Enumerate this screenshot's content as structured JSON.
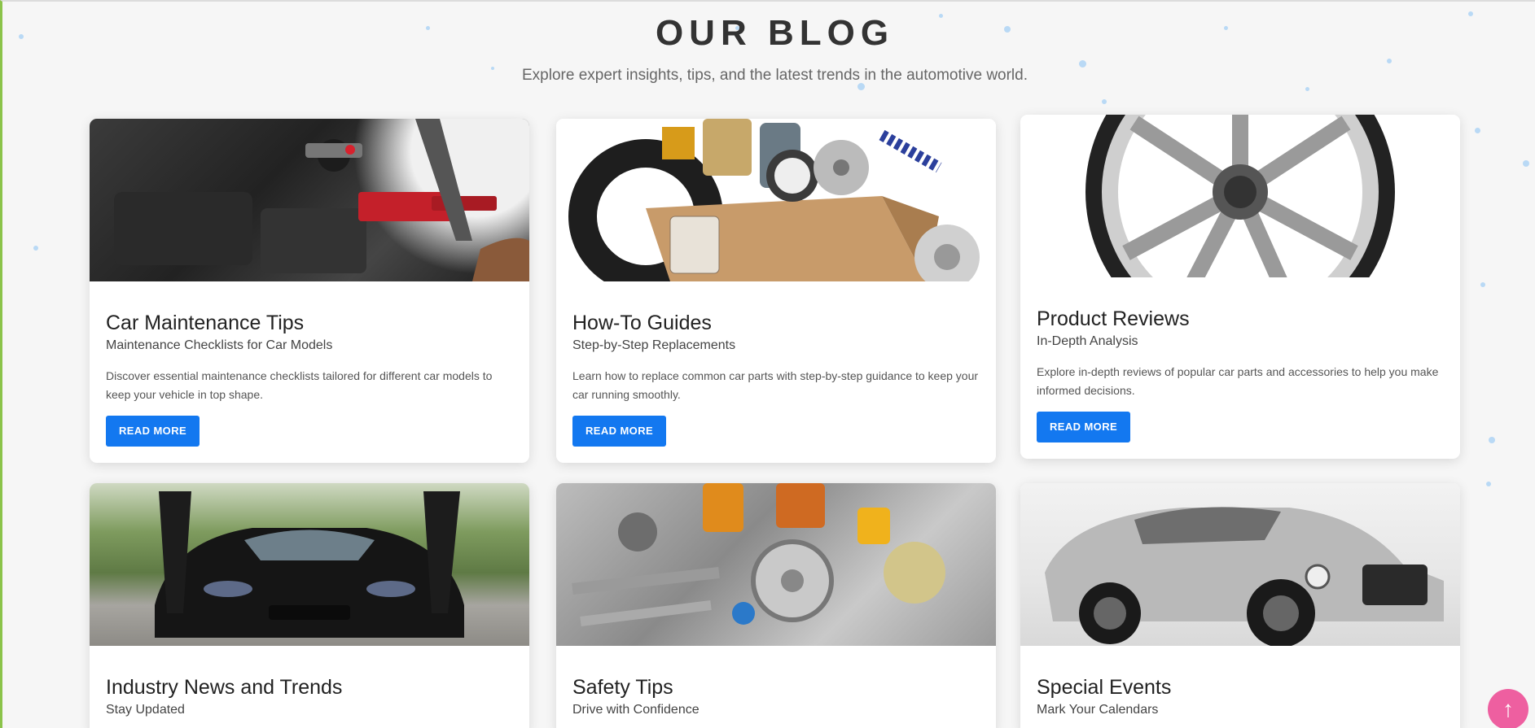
{
  "blog": {
    "title": "OUR BLOG",
    "subtitle": "Explore expert insights, tips, and the latest trends in the automotive world."
  },
  "cards": [
    {
      "title": "Car Maintenance Tips",
      "subtitle": "Maintenance Checklists for Car Models",
      "text": "Discover essential maintenance checklists tailored for different car models to keep your vehicle in top shape.",
      "button": "READ MORE"
    },
    {
      "title": "How-To Guides",
      "subtitle": "Step-by-Step Replacements",
      "text": "Learn how to replace common car parts with step-by-step guidance to keep your car running smoothly.",
      "button": "READ MORE"
    },
    {
      "title": "Product Reviews",
      "subtitle": "In-Depth Analysis",
      "text": "Explore in-depth reviews of popular car parts and accessories to help you make informed decisions.",
      "button": "READ MORE"
    },
    {
      "title": "Industry News and Trends",
      "subtitle": "Stay Updated"
    },
    {
      "title": "Safety Tips",
      "subtitle": "Drive with Confidence"
    },
    {
      "title": "Special Events",
      "subtitle": "Mark Your Calendars"
    }
  ],
  "scroll_top": {
    "icon": "arrow-up-icon",
    "glyph": "↑"
  },
  "colors": {
    "button": "#1378f0",
    "scroll_top": "#ee5fa0",
    "accent_border": "#8bc34a"
  }
}
